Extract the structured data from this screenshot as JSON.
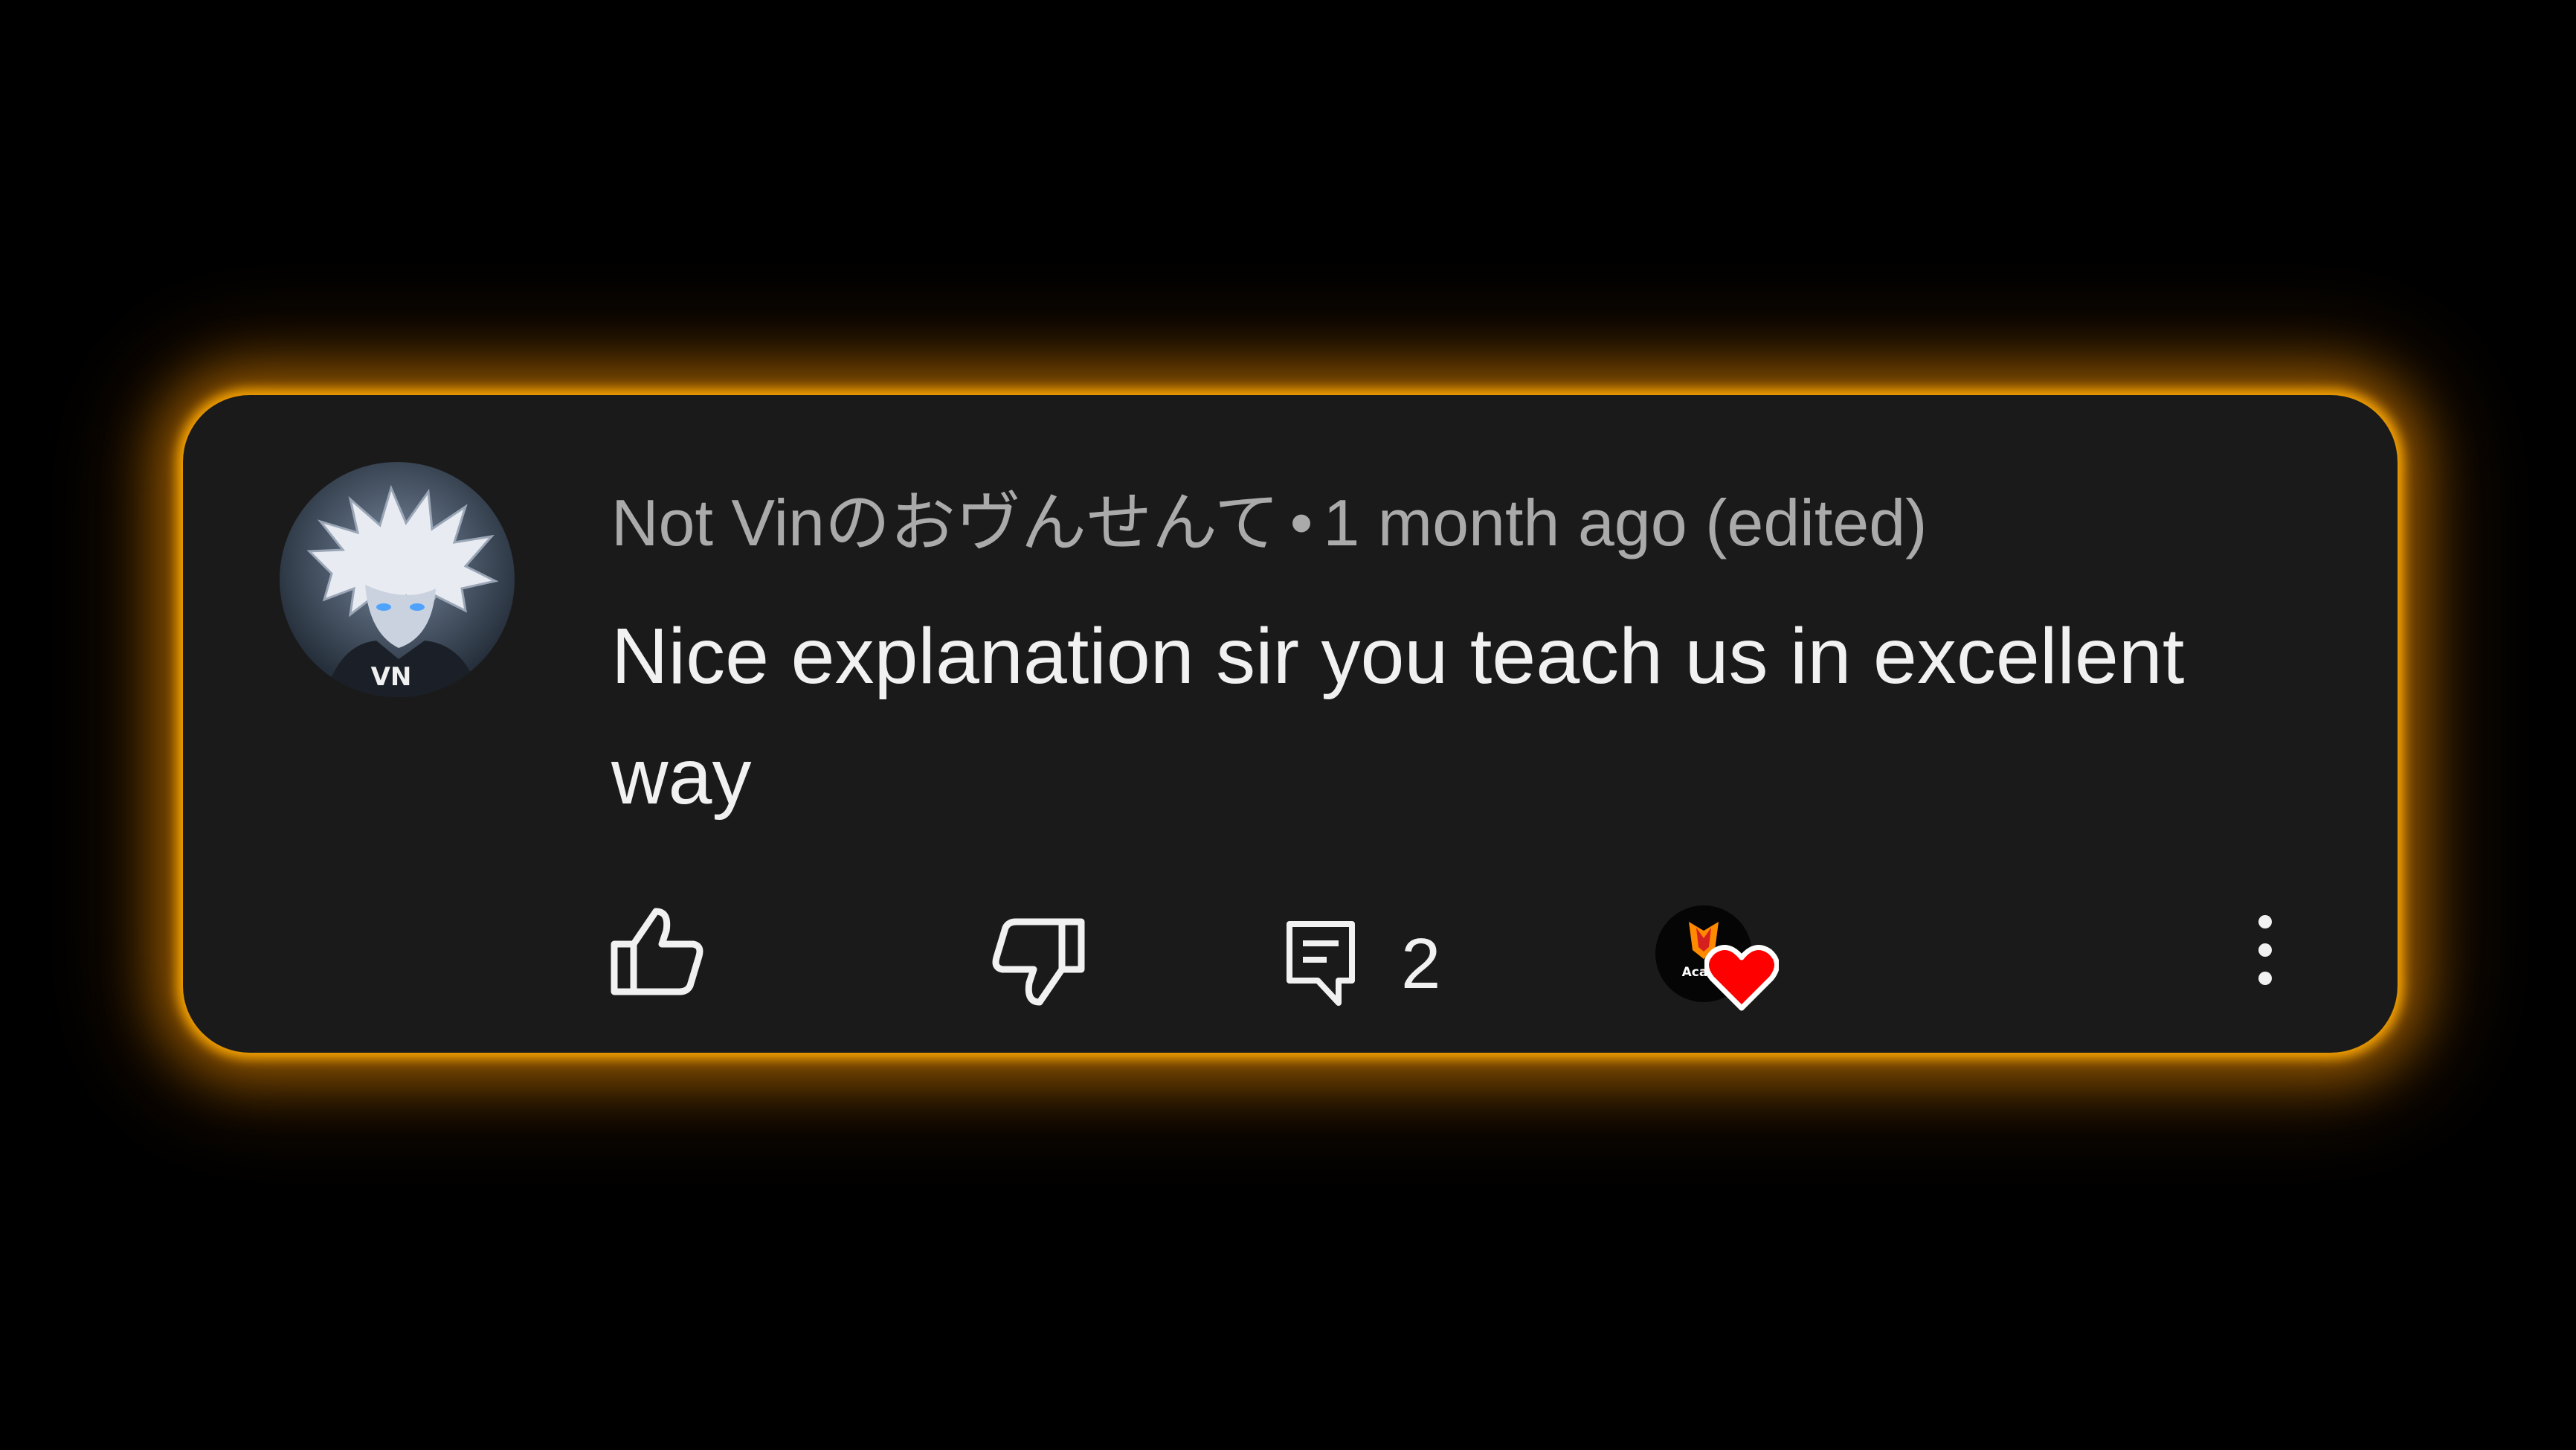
{
  "comment": {
    "author": "Not Vinのおヴんせんて",
    "separator": "•",
    "timestamp": "1 month ago (edited)",
    "text": "Nice explanation sir you teach us in excellent way",
    "reply_count": "2",
    "avatar_label": "VN",
    "creator_label": "Acadi"
  },
  "icons": {
    "like": "thumbs-up-icon",
    "dislike": "thumbs-down-icon",
    "reply": "reply-icon",
    "heart": "heart-icon",
    "more": "more-vertical-icon"
  },
  "colors": {
    "background": "#000000",
    "card": "#1a1a1a",
    "glow": "#ffaa00",
    "meta_text": "#aaaaaa",
    "body_text": "#f1f1f1",
    "heart": "#ff0000"
  }
}
